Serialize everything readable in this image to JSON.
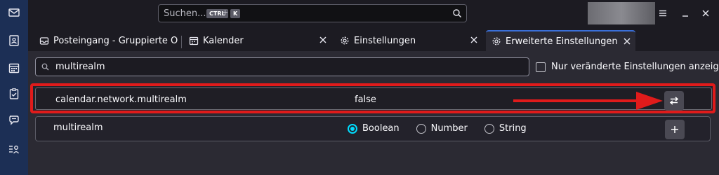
{
  "titlebar": {
    "search_placeholder": "Suchen...",
    "shortcut_mod": "CTRL",
    "shortcut_plus": "+",
    "shortcut_key": "K"
  },
  "spaces": [
    "mail-icon",
    "address-book-icon",
    "calendar-icon",
    "tasks-icon",
    "chat-icon",
    "space-settings-icon"
  ],
  "tabs": [
    {
      "label": "Posteingang - Gruppierte Ordner",
      "icon": "inbox-icon",
      "active": false
    },
    {
      "label": "Kalender",
      "icon": "calendar-icon",
      "active": false
    },
    {
      "label": "Einstellungen",
      "icon": "gear-icon",
      "active": false
    },
    {
      "label": "Erweiterte Einstellungen",
      "icon": "gear-icon",
      "active": true
    }
  ],
  "config": {
    "search_value": "multirealm",
    "modified_only_label": "Nur veränderte Einstellungen anzeigen",
    "existing_pref": {
      "name": "calendar.network.multirealm",
      "value": "false"
    },
    "new_pref": {
      "name": "multirealm",
      "types": [
        "Boolean",
        "Number",
        "String"
      ],
      "selected_type": "Boolean"
    }
  },
  "colors": {
    "accent": "#00ddff",
    "highlight": "#e01b1b",
    "active_tab_line": "#3a6fd8",
    "spaces_bg": "#1c2f55"
  }
}
